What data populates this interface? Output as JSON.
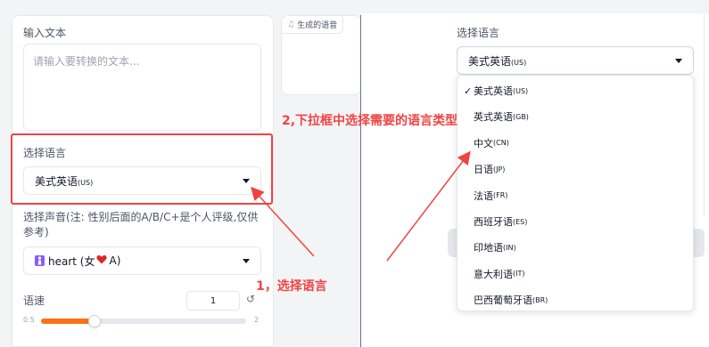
{
  "input_text": {
    "label": "输入文本",
    "placeholder": "请输入要转换的文本..."
  },
  "language": {
    "label": "选择语言",
    "selected_main": "美式英语",
    "selected_code": "(US)"
  },
  "voice": {
    "label": "选择声音(注: 性别后面的A/B/C+是个人评级,仅供参考)",
    "selected_prefix": "heart (女",
    "selected_suffix": "A)",
    "heart_color": "#dc2626"
  },
  "speed": {
    "label": "语速",
    "value": "1",
    "min_label": "0.5",
    "max_label": "2",
    "fraction": 0.26,
    "reset_icon": "↺"
  },
  "audio": {
    "label": "生成的语音",
    "icon": "♫"
  },
  "right_panel": {
    "label": "选择语言",
    "selected_main": "美式英语",
    "selected_code": "(US)"
  },
  "dropdown": {
    "check": "✓",
    "options": [
      {
        "main": "美式英语",
        "code": "(US)",
        "selected": true
      },
      {
        "main": "英式英语",
        "code": "(GB)",
        "selected": false
      },
      {
        "main": "中文",
        "code": "(CN)",
        "selected": false
      },
      {
        "main": "日语",
        "code": "(JP)",
        "selected": false
      },
      {
        "main": "法语",
        "code": "(FR)",
        "selected": false
      },
      {
        "main": "西班牙语",
        "code": "(ES)",
        "selected": false
      },
      {
        "main": "印地语",
        "code": "(IN)",
        "selected": false
      },
      {
        "main": "意大利语",
        "code": "(IT)",
        "selected": false
      },
      {
        "main": "巴西葡萄牙语",
        "code": "(BR)",
        "selected": false
      }
    ]
  },
  "annotations": {
    "step1": "1，选择语言",
    "step2": "2,下拉框中选择需要的语言类型",
    "color": "#ef4444"
  },
  "colors": {
    "accent": "#f97316",
    "track": "#e5e7eb"
  }
}
